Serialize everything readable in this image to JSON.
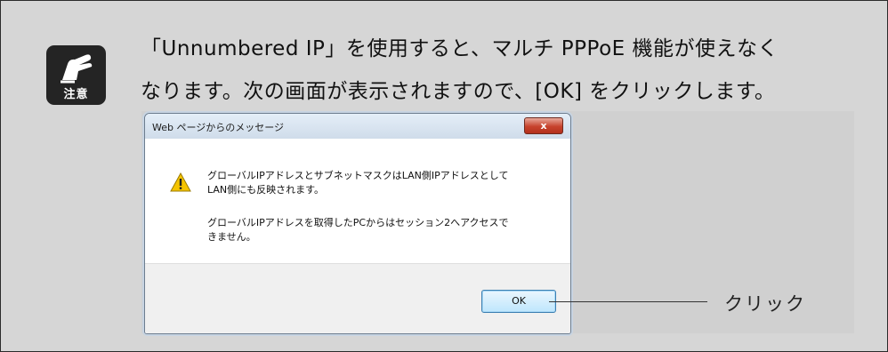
{
  "note": {
    "icon_label": "注意",
    "line1": "「Unnumbered IP」を使用すると、マルチ PPPoE 機能が使えなく",
    "line2": "なります。次の画面が表示されますので、[OK] をクリックします。"
  },
  "dialog": {
    "title": "Web ページからのメッセージ",
    "close_label": "x",
    "message_line1": "グローバルIPアドレスとサブネットマスクはLAN側IPアドレスとして",
    "message_line2": "LAN側にも反映されます。",
    "message_line3": "グローバルIPアドレスを取得したPCからはセッション2へアクセスで",
    "message_line4": "きません。",
    "ok_label": "OK"
  },
  "callout": {
    "label": "クリック"
  },
  "colors": {
    "panel_bg": "#d6d6d6",
    "icon_bg": "#242424",
    "close_button": "#c7432d",
    "warning_yellow": "#f5c400"
  }
}
